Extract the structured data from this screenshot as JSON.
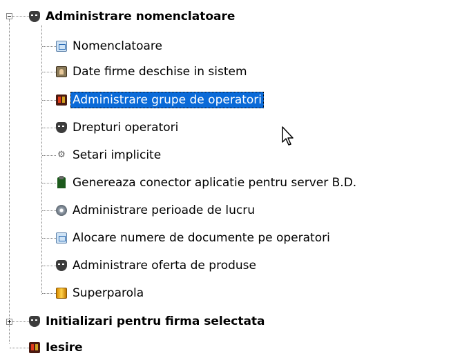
{
  "tree": {
    "root": {
      "label": "Administrare nomenclatoare",
      "expanded": true,
      "icon": "mask-icon"
    },
    "children": [
      {
        "label": "Nomenclatoare",
        "icon": "document-icon"
      },
      {
        "label": "Date firme deschise in sistem",
        "icon": "photo-icon"
      },
      {
        "label": "Administrare grupe de operatori",
        "icon": "group-icon",
        "selected": true
      },
      {
        "label": "Drepturi operatori",
        "icon": "mask-icon"
      },
      {
        "label": "Setari implicite",
        "icon": "gears-icon"
      },
      {
        "label": "Genereaza conector aplicatie pentru server B.D.",
        "icon": "plug-icon"
      },
      {
        "label": "Administrare perioade de lucru",
        "icon": "disk-icon"
      },
      {
        "label": "Alocare numere de documente pe operatori",
        "icon": "document-icon"
      },
      {
        "label": "Administrare oferta de produse",
        "icon": "mask-icon"
      },
      {
        "label": "Superparola",
        "icon": "gold-icon"
      }
    ],
    "siblings": [
      {
        "label": "Initializari pentru firma selectata",
        "icon": "mask-icon",
        "expanded": false
      },
      {
        "label": "Iesire",
        "icon": "group-icon"
      }
    ]
  },
  "colors": {
    "selection": "#0a6ad8",
    "tree_lines": "#808080"
  }
}
